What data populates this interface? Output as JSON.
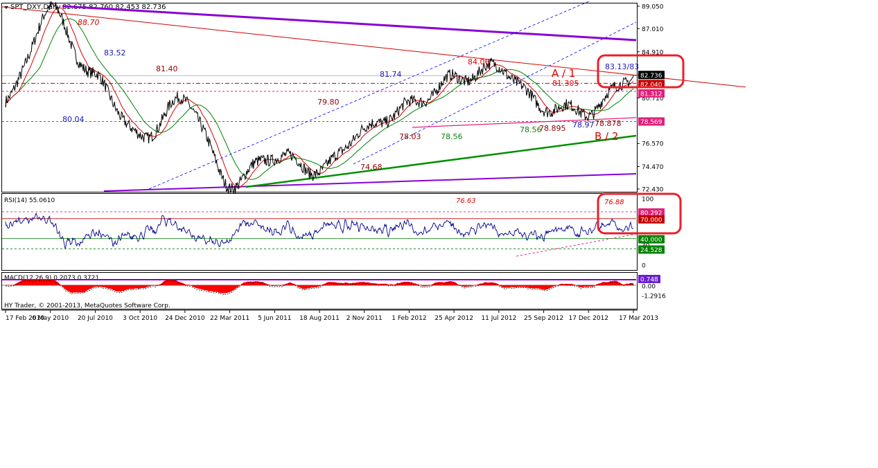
{
  "header": {
    "title": "SPT_DXY,Daily",
    "ohlc": "82.675 82.760 82.453 82.736"
  },
  "footer": "HY Trader, © 2001-2013, MetaQuotes Software Corp.",
  "colors": {
    "price": "#000000",
    "ma_fast": "#d40000",
    "ma_slow": "#008000",
    "channel": "#0000ff",
    "purple": "#8a00d4",
    "support": "#009000",
    "rsi": "#00008b",
    "macd_hist": "#ff0000",
    "highlight": "#e8202a",
    "price_tag": "#000000",
    "red_tag": "#c00000",
    "magenta_tag": "#e0207a",
    "green_tag": "#008000"
  },
  "chart_data": [
    {
      "type": "line",
      "panel": "price",
      "x": [
        "17 Feb 2010",
        "6 May 2010",
        "20 Jul 2010",
        "3 Oct 2010",
        "24 Dec 2010",
        "22 Mar 2011",
        "5 Jun 2011",
        "18 Aug 2011",
        "2 Nov 2011",
        "1 Feb 2012",
        "25 Apr 2012",
        "11 Jul 2012",
        "25 Sep 2012",
        "17 Dec 2012",
        "17 Mar 2013"
      ],
      "ylim": [
        72.43,
        89.05
      ],
      "y_ticks": [
        "89.050",
        "87.010",
        "84.910",
        "82.736",
        "80.710",
        "78.569",
        "76.570",
        "74.470",
        "72.430"
      ],
      "key_points": [
        {
          "x": "17 Feb 2010",
          "y": 80.4
        },
        {
          "x": "6 May 2010",
          "y": 88.7
        },
        {
          "x": "20 Jul 2010",
          "y": 82.5
        },
        {
          "x": "3 Oct 2010",
          "y": 77.1
        },
        {
          "x": "24 Dec 2010",
          "y": 80.6
        },
        {
          "x": "22 Mar 2011",
          "y": 72.9
        },
        {
          "x": "5 Jun 2011",
          "y": 75.5
        },
        {
          "x": "18 Aug 2011",
          "y": 74.1
        },
        {
          "x": "2 Nov 2011",
          "y": 77.8
        },
        {
          "x": "1 Feb 2012",
          "y": 80.0
        },
        {
          "x": "25 Apr 2012",
          "y": 82.4
        },
        {
          "x": "11 Jul 2012",
          "y": 83.5
        },
        {
          "x": "25 Sep 2012",
          "y": 79.9
        },
        {
          "x": "17 Dec 2012",
          "y": 79.5
        },
        {
          "x": "17 Mar 2013",
          "y": 82.736
        }
      ],
      "price_tags": [
        {
          "label": "82.736",
          "kind": "price"
        },
        {
          "label": "82.040",
          "kind": "red"
        },
        {
          "label": "81.312",
          "kind": "magenta"
        },
        {
          "label": "78.569",
          "kind": "magenta"
        }
      ],
      "annotations": [
        {
          "text": "88.70",
          "color": "red"
        },
        {
          "text": "83.52",
          "color": "blue"
        },
        {
          "text": "81.40",
          "color": "darkred"
        },
        {
          "text": "80.04",
          "color": "blue"
        },
        {
          "text": "79.80",
          "color": "darkred"
        },
        {
          "text": "74.68",
          "color": "darkred"
        },
        {
          "text": "81.74",
          "color": "blue"
        },
        {
          "text": "78.03",
          "color": "darkred"
        },
        {
          "text": "78.56",
          "color": "green"
        },
        {
          "text": "84.06",
          "color": "red"
        },
        {
          "text": "78.56",
          "color": "green"
        },
        {
          "text": "78.895",
          "color": "darkred"
        },
        {
          "text": "78.97",
          "color": "blue"
        },
        {
          "text": "78.878",
          "color": "darkred"
        },
        {
          "text": "81.305",
          "color": "red"
        },
        {
          "text": "A / 1",
          "color": "red"
        },
        {
          "text": "B / 2",
          "color": "red"
        },
        {
          "text": "83.13/83",
          "color": "blue"
        }
      ]
    },
    {
      "type": "line",
      "panel": "rsi",
      "title": "RSI(14) 55.0610",
      "ylim": [
        0,
        100
      ],
      "y_ticks": [
        "100",
        "30",
        "0"
      ],
      "levels": [
        {
          "label": "80.292",
          "kind": "magenta"
        },
        {
          "label": "70.000",
          "kind": "red"
        },
        {
          "label": "40.000",
          "kind": "green"
        },
        {
          "label": "24.528",
          "kind": "green"
        }
      ],
      "annotations": [
        {
          "text": "76.63"
        },
        {
          "text": "76.88"
        }
      ],
      "last": 55.061
    },
    {
      "type": "bar",
      "panel": "macd",
      "title": "MACD(12,26,9) 0.2073 0.3721",
      "y_ticks": [
        "0.748",
        "0.00",
        "-1.2916"
      ]
    }
  ]
}
